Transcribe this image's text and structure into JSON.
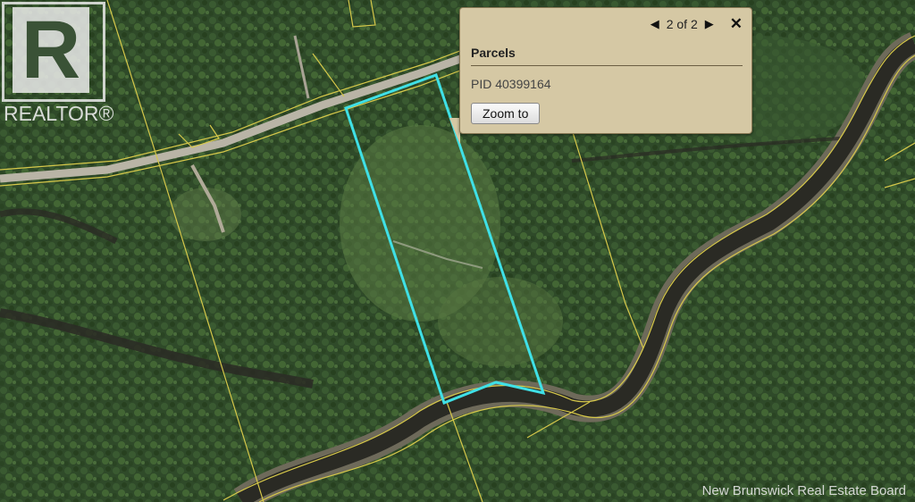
{
  "logo": {
    "text": "REALTOR®",
    "letter": "R"
  },
  "popup": {
    "prev_icon": "triangle-left",
    "next_icon": "triangle-right",
    "counter": "2 of 2",
    "close_label": "✕",
    "title": "Parcels",
    "fields": [
      {
        "label": "PID",
        "value": "40399164"
      }
    ],
    "zoom_label": "Zoom to"
  },
  "map": {
    "parcel_outline_color": "#3fe0e6",
    "lot_line_color": "#d6c84a",
    "road_color": "#b9b4a6",
    "river_color": "#2a2a24"
  },
  "watermark": "New Brunswick Real Estate Board"
}
